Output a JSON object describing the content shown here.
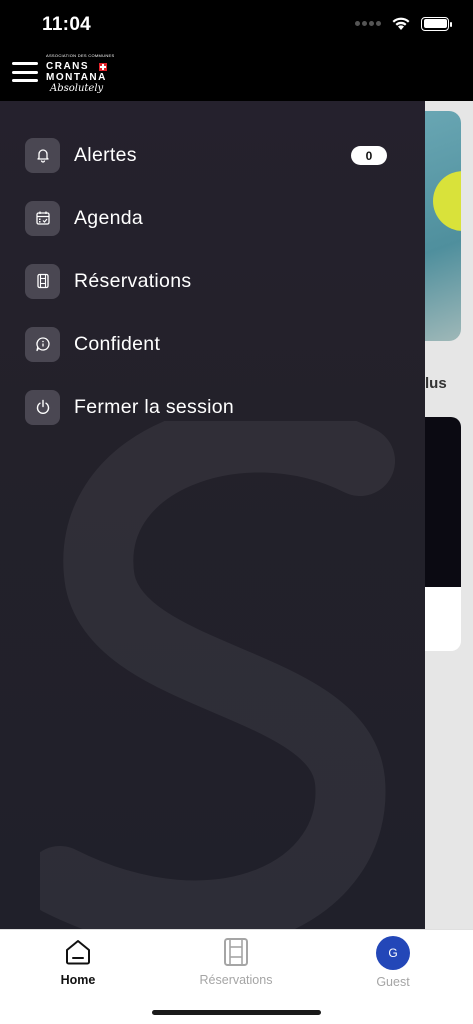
{
  "status_bar": {
    "time": "11:04"
  },
  "header": {
    "logo": {
      "line1": "ASSOCIATION DES COMMUNES",
      "line2": "CRANS",
      "line3": "MONTANA",
      "line4": "Absolutely"
    }
  },
  "drawer": {
    "items": [
      {
        "label": "Alertes",
        "icon": "bell-icon",
        "badge": "0"
      },
      {
        "label": "Agenda",
        "icon": "calendar-icon"
      },
      {
        "label": "Réservations",
        "icon": "film-icon"
      },
      {
        "label": "Confident",
        "icon": "chat-info-icon"
      },
      {
        "label": "Fermer la session",
        "icon": "power-icon"
      }
    ]
  },
  "background": {
    "partial_text": "lus"
  },
  "tabbar": {
    "tabs": [
      {
        "label": "Home",
        "icon": "home-icon",
        "active": true
      },
      {
        "label": "Réservations",
        "icon": "film-icon",
        "active": false
      },
      {
        "label": "Guest",
        "icon": "avatar",
        "avatar_initial": "G",
        "active": false
      }
    ]
  },
  "colors": {
    "drawer_bg": "#23212a",
    "icon_box": "#4a4752",
    "avatar_bg": "#2347b8",
    "header_bg": "#000000"
  }
}
